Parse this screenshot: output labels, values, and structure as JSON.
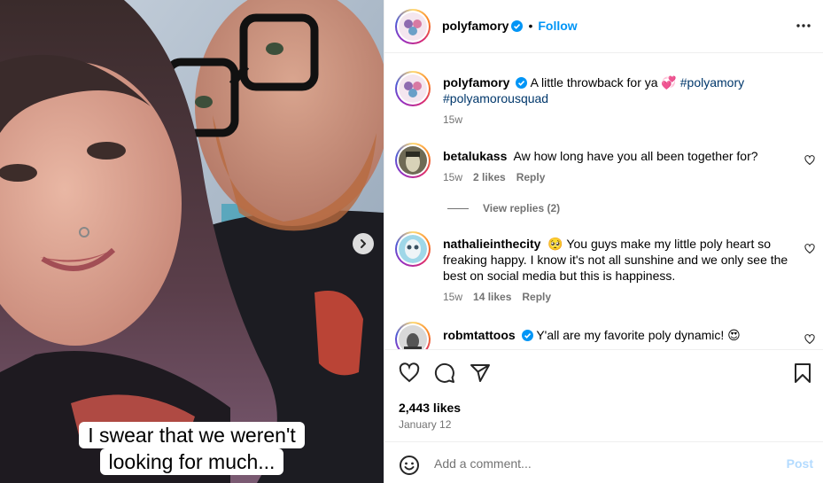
{
  "colors": {
    "accent": "#0095f6",
    "hashtag": "#00376b",
    "muted": "#737373",
    "border": "#efefef",
    "post_disabled": "#b3dbff"
  },
  "media": {
    "caption_line1": "I swear that we weren't",
    "caption_line2": "looking for much...",
    "next_icon": "chevron-right-icon"
  },
  "header": {
    "username": "polyfamory",
    "separator": "•",
    "follow_label": "Follow",
    "more_icon": "more-horizontal-icon"
  },
  "caption": {
    "username": "polyfamory",
    "text": "A little throwback for ya 💞",
    "hashtag1": "#polyamory",
    "hashtag2": "#polyamorousquad",
    "time": "15w"
  },
  "comments": [
    {
      "username": "betalukass",
      "text": "Aw how long have you all been together for?",
      "time": "15w",
      "likes": "2 likes",
      "reply": "Reply"
    },
    {
      "username": "nathalieinthecity",
      "text": "🥺 You guys make my little poly heart so freaking happy. I know it's not all sunshine and we only see the best on social media but this is happiness.",
      "time": "15w",
      "likes": "14 likes",
      "reply": "Reply"
    },
    {
      "username": "robmtattoos",
      "text": "Y'all are my favorite poly dynamic! 😍"
    }
  ],
  "view_replies": "View replies (2)",
  "actions": {
    "like_icon": "heart-icon",
    "comment_icon": "comment-icon",
    "share_icon": "share-icon",
    "save_icon": "bookmark-icon",
    "likes_count": "2,443 likes",
    "date": "January 12"
  },
  "add_comment": {
    "placeholder": "Add a comment...",
    "post_label": "Post",
    "emoji_icon": "emoji-icon"
  }
}
